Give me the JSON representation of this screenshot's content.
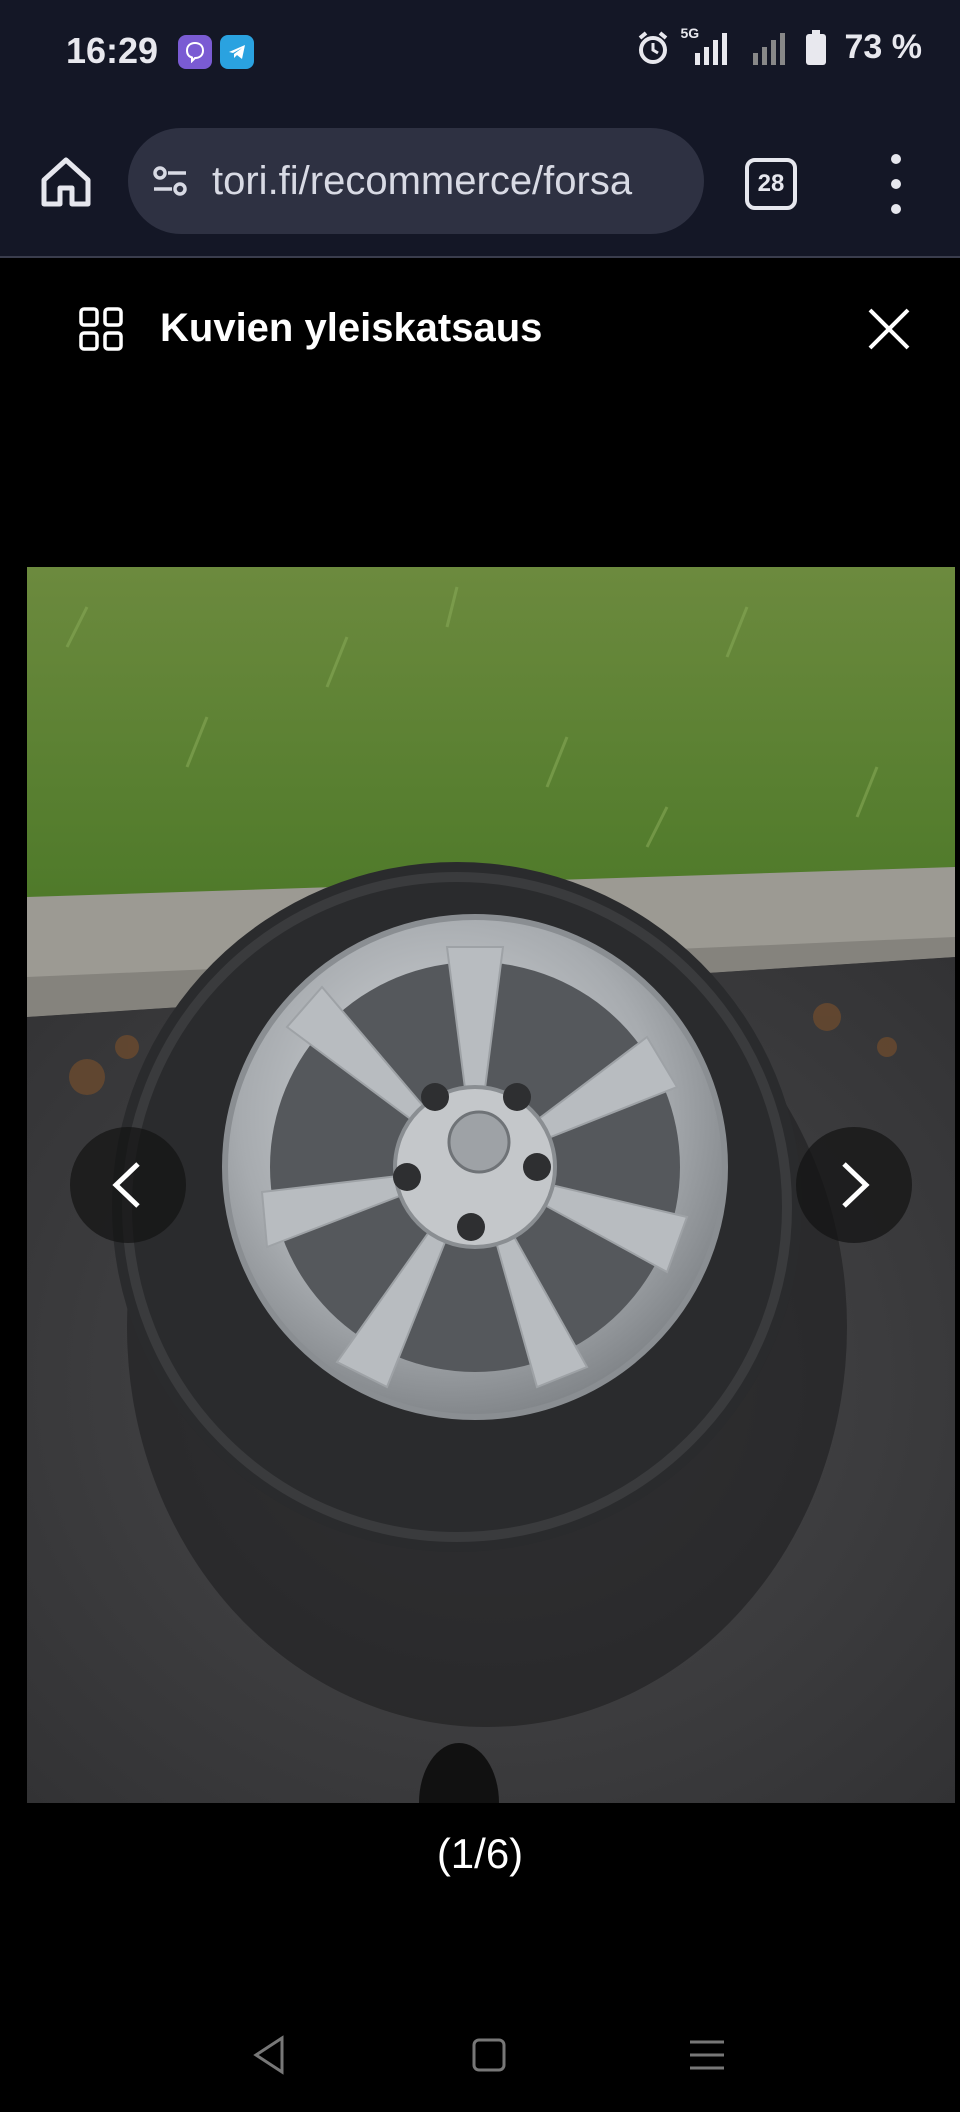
{
  "status_bar": {
    "time": "16:29",
    "network": "5G",
    "battery": "73 %",
    "apps": [
      "viber-icon",
      "telegram-icon"
    ],
    "indicators": [
      "alarm-icon",
      "signal-icon",
      "signal-icon",
      "battery-icon"
    ]
  },
  "browser": {
    "url": "tori.fi/recommerce/forsa",
    "tab_count": "28"
  },
  "viewer": {
    "title": "Kuvien yleiskatsaus",
    "counter": "(1/6)"
  },
  "colors": {
    "status_bg": "#141726",
    "url_pill": "#2e3142",
    "viewer_bg": "#000000"
  }
}
